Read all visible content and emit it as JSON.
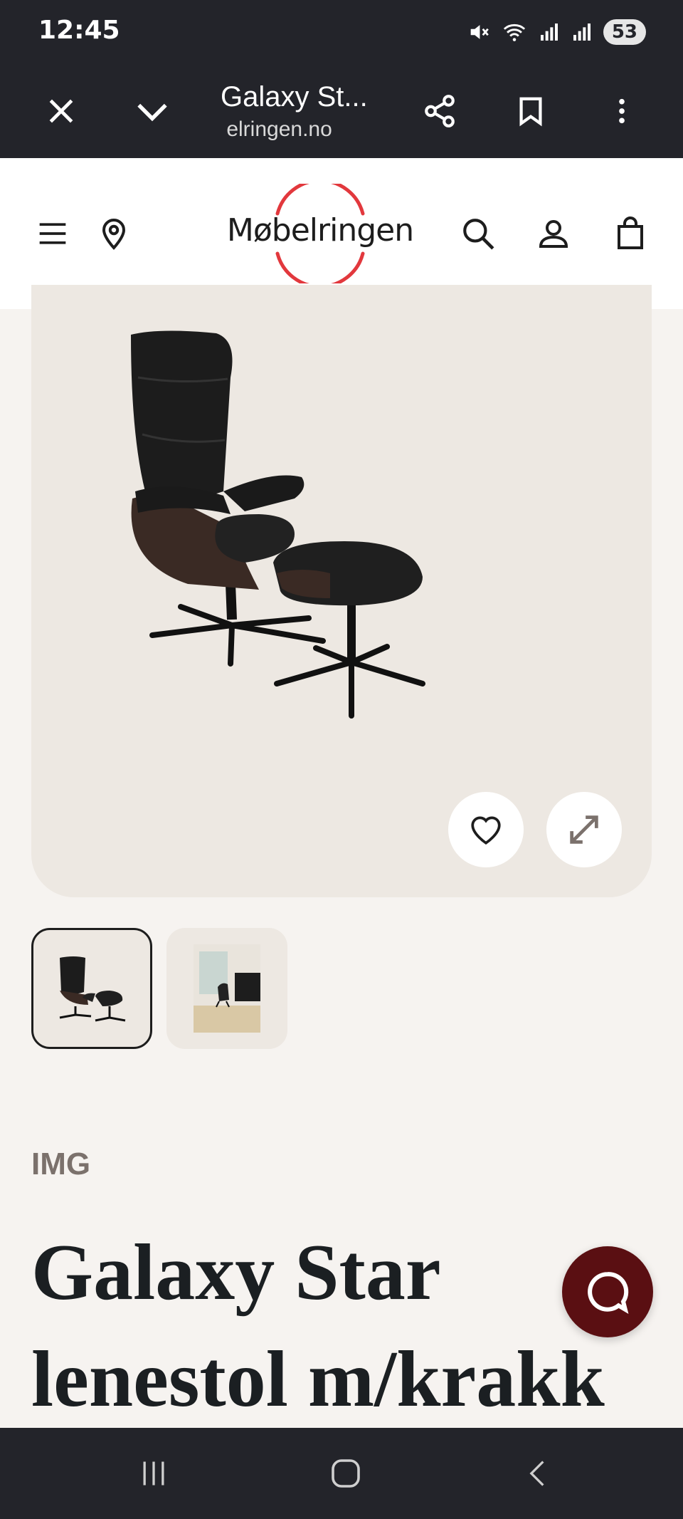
{
  "status_bar": {
    "time": "12:45",
    "battery": "53",
    "icons": [
      "mute-icon",
      "wifi-icon",
      "signal-icon",
      "signal-r-icon"
    ]
  },
  "browser": {
    "tab_title": "Galaxy St...",
    "url": " elringen.no",
    "buttons": [
      "close-icon",
      "chevron-down-icon",
      "share-icon",
      "bookmark-icon",
      "more-icon"
    ]
  },
  "header": {
    "logo_text": "Møbelringen",
    "icons": [
      "menu-icon",
      "location-pin-icon",
      "search-icon",
      "account-icon",
      "bag-icon"
    ]
  },
  "product": {
    "brand": "IMG",
    "title": "Galaxy Star lenestol m/krakk",
    "thumbnails": [
      "chair-with-stool",
      "chair-in-room"
    ]
  },
  "colors": {
    "accent_red": "#e2383d",
    "chat_button": "#5a0f12",
    "page_bg": "#f6f3f0",
    "image_bg": "#ede8e2"
  }
}
